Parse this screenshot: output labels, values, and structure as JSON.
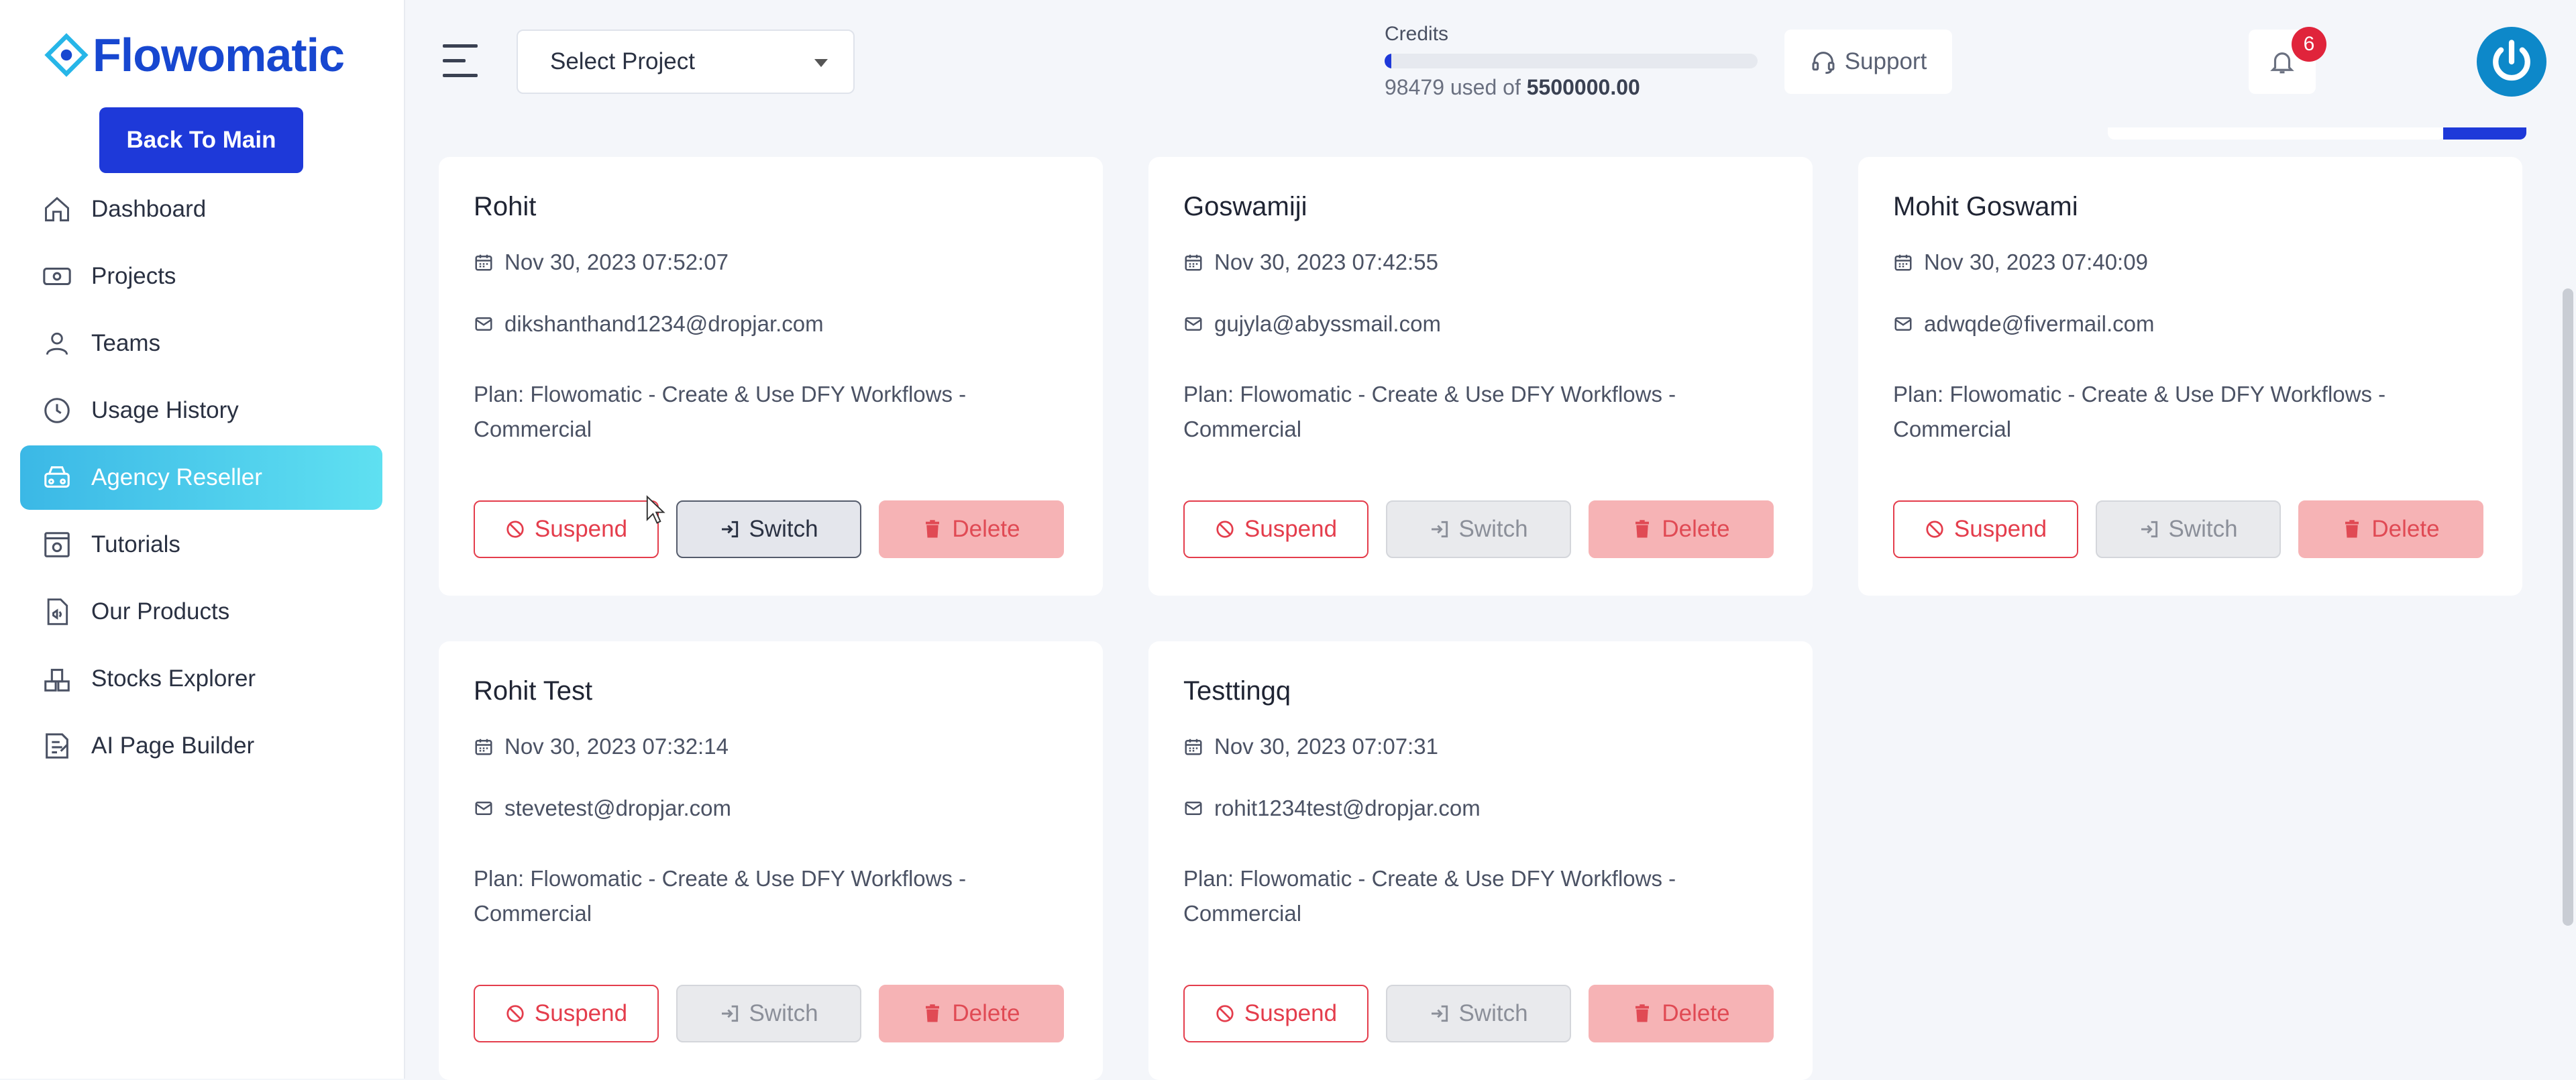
{
  "sidebar": {
    "brand": "Flowomatic",
    "back_button": "Back To Main",
    "items": [
      {
        "label": "Dashboard",
        "icon": "home-icon"
      },
      {
        "label": "Projects",
        "icon": "projects-icon"
      },
      {
        "label": "Teams",
        "icon": "user-icon"
      },
      {
        "label": "Usage History",
        "icon": "history-icon"
      },
      {
        "label": "Agency Reseller",
        "icon": "agency-icon",
        "active": true
      },
      {
        "label": "Tutorials",
        "icon": "tutorials-icon"
      },
      {
        "label": "Our Products",
        "icon": "products-icon"
      },
      {
        "label": "Stocks Explorer",
        "icon": "stocks-icon"
      },
      {
        "label": "AI Page Builder",
        "icon": "page-builder-icon"
      }
    ]
  },
  "topbar": {
    "select_project": "Select Project",
    "credits_label": "Credits",
    "credits_used": "98479",
    "credits_used_of": "used of",
    "credits_total": "5500000.00",
    "credits_fraction": 0.0179,
    "support_label": "Support",
    "notification_count": "6"
  },
  "colors": {
    "brand": "#1747d0",
    "primary": "#1e39d9",
    "danger": "#e43d4c",
    "active_nav_start": "#3bb8e6",
    "active_nav_end": "#5fe0f1",
    "avatar": "#0d88c9"
  },
  "cards": [
    {
      "name": "Rohit",
      "date": "Nov 30, 2023 07:52:07",
      "email": "dikshanthand1234@dropjar.com",
      "plan_line1": "Plan: Flowomatic - Create & Use DFY Workflows -",
      "plan_line2": "Commercial",
      "suspend": "Suspend",
      "switch": "Switch",
      "delete": "Delete"
    },
    {
      "name": "Goswamiji",
      "date": "Nov 30, 2023 07:42:55",
      "email": "gujyla@abyssmail.com",
      "plan_line1": "Plan: Flowomatic - Create & Use DFY Workflows -",
      "plan_line2": "Commercial",
      "suspend": "Suspend",
      "switch": "Switch",
      "delete": "Delete"
    },
    {
      "name": "Mohit Goswami",
      "date": "Nov 30, 2023 07:40:09",
      "email": "adwqde@fivermail.com",
      "plan_line1": "Plan: Flowomatic - Create & Use DFY Workflows -",
      "plan_line2": "Commercial",
      "suspend": "Suspend",
      "switch": "Switch",
      "delete": "Delete"
    },
    {
      "name": "Rohit Test",
      "date": "Nov 30, 2023 07:32:14",
      "email": "stevetest@dropjar.com",
      "plan_line1": "Plan: Flowomatic - Create & Use DFY Workflows -",
      "plan_line2": "Commercial",
      "suspend": "Suspend",
      "switch": "Switch",
      "delete": "Delete"
    },
    {
      "name": "Testtingq",
      "date": "Nov 30, 2023 07:07:31",
      "email": "rohit1234test@dropjar.com",
      "plan_line1": "Plan: Flowomatic - Create & Use DFY Workflows -",
      "plan_line2": "Commercial",
      "suspend": "Suspend",
      "switch": "Switch",
      "delete": "Delete"
    }
  ]
}
